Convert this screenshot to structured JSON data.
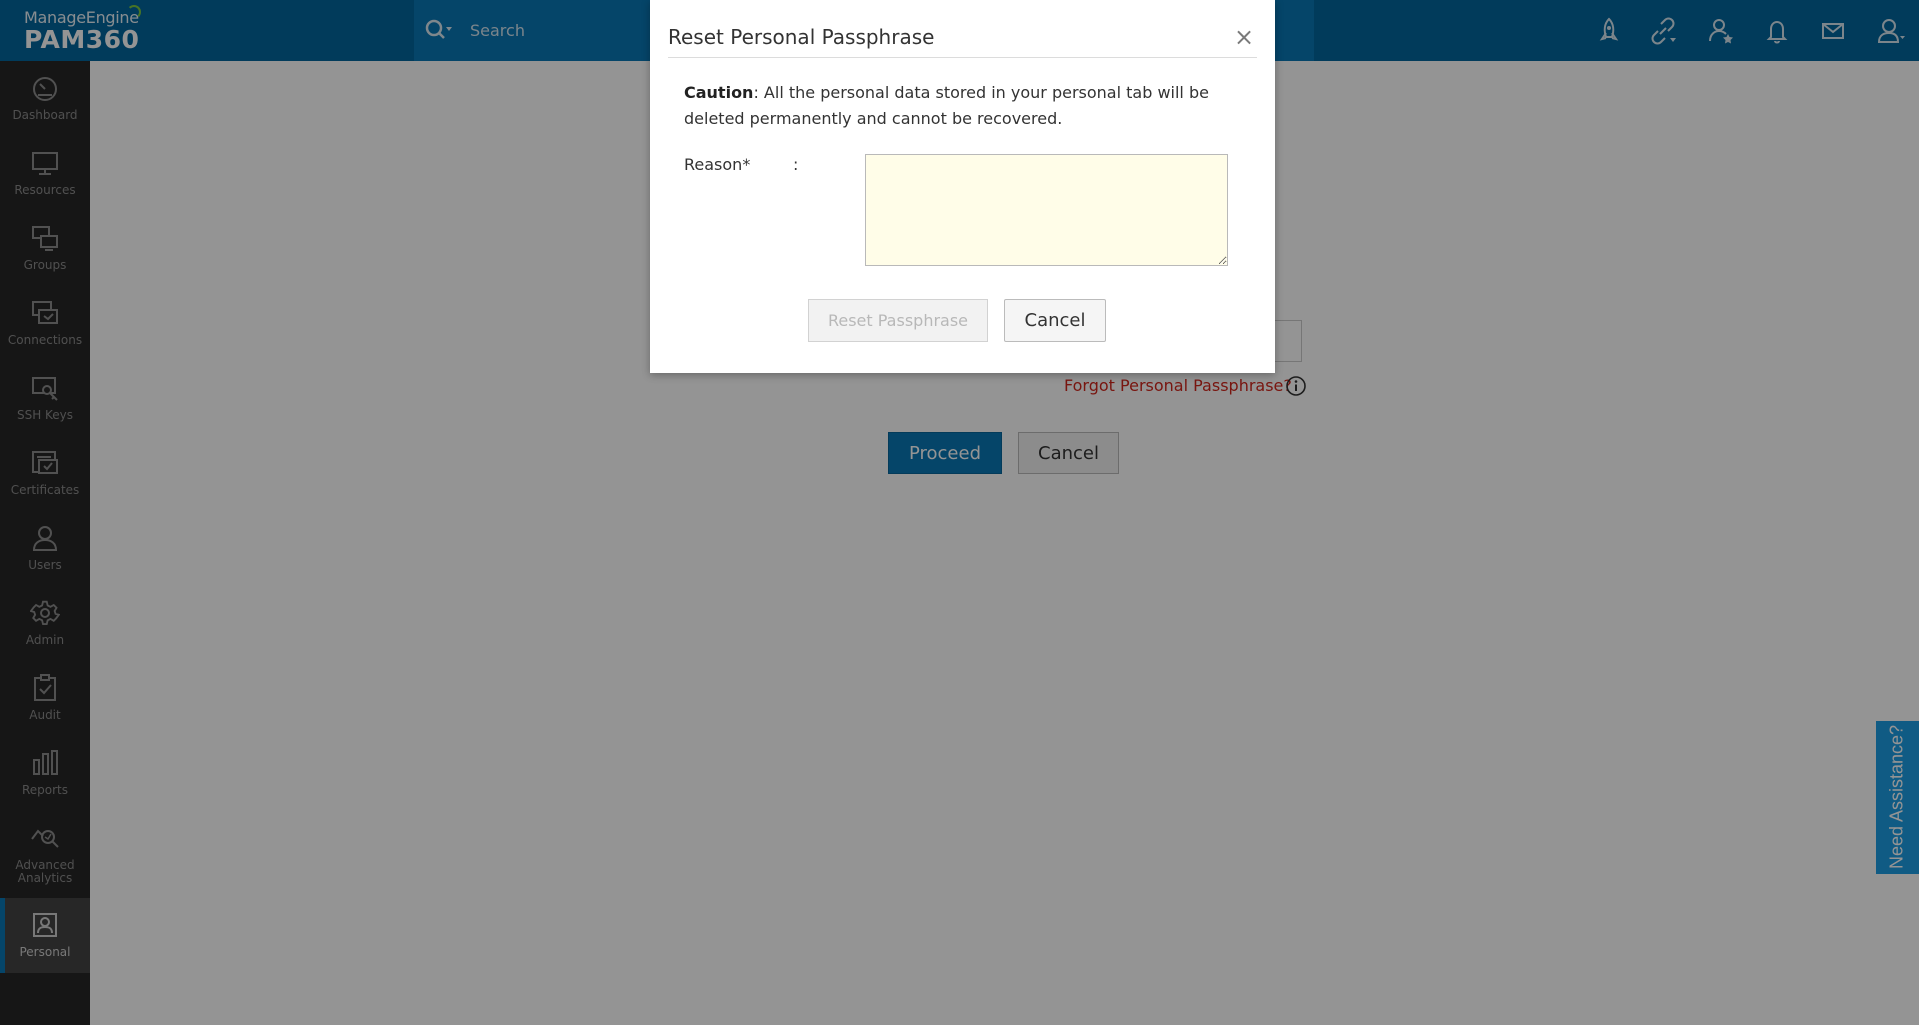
{
  "header": {
    "brand_top": "ManageEngine",
    "brand_bottom": "PAM360",
    "search_placeholder": "Search",
    "icons": [
      "rocket-icon",
      "link-icon",
      "user-star-icon",
      "bell-icon",
      "mail-icon",
      "user-icon"
    ]
  },
  "sidebar": {
    "items": [
      {
        "label": "Dashboard",
        "icon": "dashboard-icon"
      },
      {
        "label": "Resources",
        "icon": "monitor-icon"
      },
      {
        "label": "Groups",
        "icon": "groups-icon"
      },
      {
        "label": "Connections",
        "icon": "connections-icon"
      },
      {
        "label": "SSH Keys",
        "icon": "ssh-key-icon"
      },
      {
        "label": "Certificates",
        "icon": "certificate-icon"
      },
      {
        "label": "Users",
        "icon": "users-icon"
      },
      {
        "label": "Admin",
        "icon": "gear-icon"
      },
      {
        "label": "Audit",
        "icon": "clipboard-check-icon"
      },
      {
        "label": "Reports",
        "icon": "bar-chart-icon"
      },
      {
        "label": "Advanced Analytics",
        "label_line1": "Advanced",
        "label_line2": "Analytics",
        "icon": "analytics-icon"
      },
      {
        "label": "Personal",
        "icon": "personal-icon",
        "active": true
      }
    ]
  },
  "main": {
    "forgot_link": "Forgot Personal Passphrase?",
    "proceed_label": "Proceed",
    "cancel_label": "Cancel"
  },
  "assist": {
    "label": "Need Assistance?"
  },
  "dialog": {
    "title": "Reset Personal Passphrase",
    "close_symbol": "×",
    "caution_label": "Caution",
    "caution_text": ": All the personal data stored in your personal tab will be deleted permanently and cannot be recovered.",
    "reason_label": "Reason*",
    "reason_colon": ":",
    "reason_value": "",
    "reset_label": "Reset Passphrase",
    "cancel_label": "Cancel"
  },
  "colors": {
    "header_bg": "#03679d",
    "search_bg": "#0a78b6",
    "sidebar_bg": "#272727",
    "accent": "#0a78b6",
    "link_red": "#d0271d",
    "textarea_bg": "#fffde8",
    "assist_bg": "#1d9ee4"
  }
}
